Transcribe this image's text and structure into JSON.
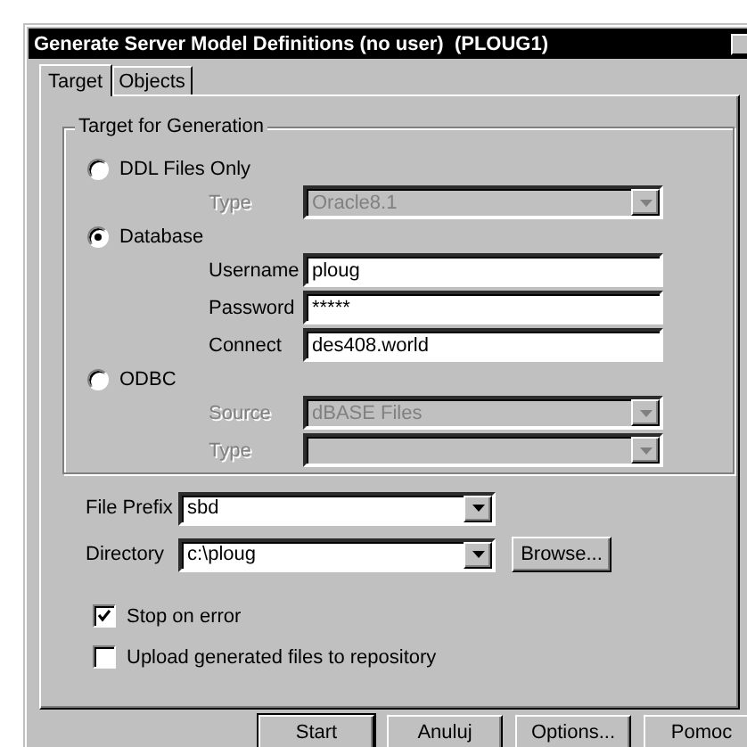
{
  "window": {
    "title": "Generate Server Model Definitions (no user)  (PLOUG1)"
  },
  "tabs": [
    {
      "label": "Target",
      "selected": true
    },
    {
      "label": "Objects",
      "selected": false
    }
  ],
  "target_group": {
    "title": "Target for Generation",
    "options": [
      {
        "label": "DDL Files Only",
        "selected": false,
        "fields": [
          {
            "label": "Type",
            "kind": "dropdown",
            "value": "Oracle8.1",
            "disabled": true
          }
        ]
      },
      {
        "label": "Database",
        "selected": true,
        "fields": [
          {
            "label": "Username",
            "kind": "text",
            "value": "ploug",
            "disabled": false
          },
          {
            "label": "Password",
            "kind": "text",
            "value": "*****",
            "disabled": false
          },
          {
            "label": "Connect",
            "kind": "text",
            "value": "des408.world",
            "disabled": false
          }
        ]
      },
      {
        "label": "ODBC",
        "selected": false,
        "fields": [
          {
            "label": "Source",
            "kind": "dropdown",
            "value": "dBASE Files",
            "disabled": true
          },
          {
            "label": "Type",
            "kind": "dropdown",
            "disabled": true
          }
        ]
      }
    ]
  },
  "file_prefix": {
    "label": "File Prefix",
    "value": "sbd"
  },
  "directory": {
    "label": "Directory",
    "value": "c:\\ploug",
    "button": "Browse..."
  },
  "checkboxes": [
    {
      "label": "Stop on error",
      "checked": true
    },
    {
      "label": "Upload generated files to repository",
      "checked": false
    }
  ],
  "buttons": [
    {
      "label": "Start",
      "default": true
    },
    {
      "label": "Anuluj",
      "default": false
    },
    {
      "label": "Options...",
      "default": false
    },
    {
      "label": "Pomoc",
      "default": false
    }
  ]
}
